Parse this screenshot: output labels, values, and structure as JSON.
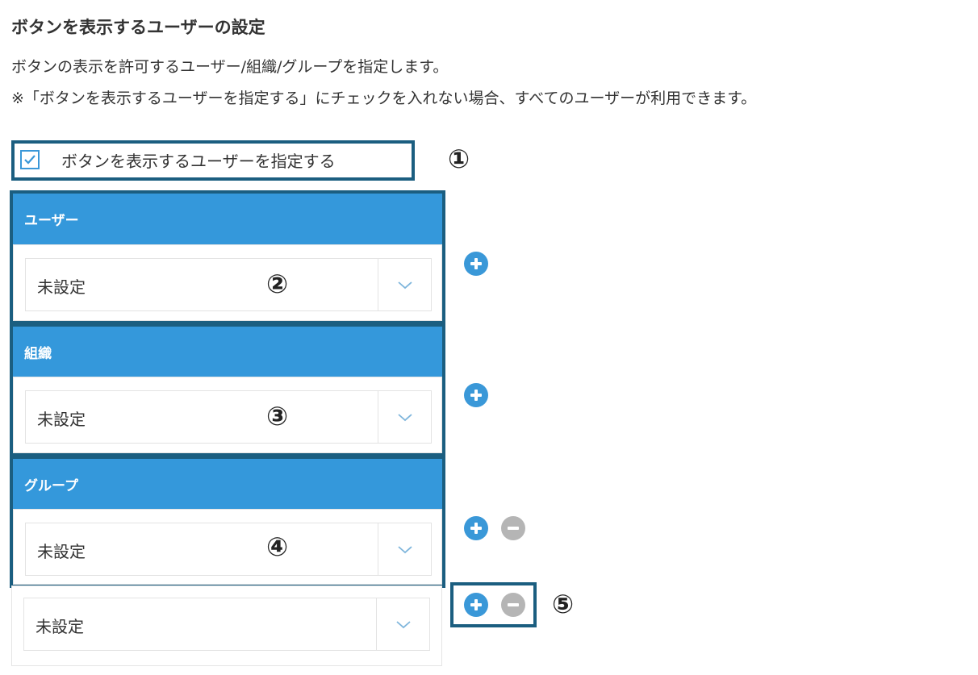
{
  "header": {
    "title": "ボタンを表示するユーザーの設定",
    "description_1": "ボタンの表示を許可するユーザー/組織/グループを指定します。",
    "description_2": "※「ボタンを表示するユーザーを指定する」にチェックを入れない場合、すべてのユーザーが利用できます。"
  },
  "checkbox": {
    "label": "ボタンを表示するユーザーを指定する",
    "checked": true
  },
  "callouts": {
    "n1": "①",
    "n2": "②",
    "n3": "③",
    "n4": "④",
    "n5": "⑤"
  },
  "sections": [
    {
      "heading": "ユーザー",
      "selected": "未設定"
    },
    {
      "heading": "組織",
      "selected": "未設定"
    },
    {
      "heading": "グループ",
      "selected": "未設定"
    }
  ],
  "extra_select": {
    "selected": "未設定"
  },
  "icons": {
    "add": "plus-circle-icon",
    "remove": "minus-circle-icon",
    "dropdown": "chevron-down-icon",
    "check": "checkmark-icon"
  },
  "colors": {
    "accent_blue": "#3498db",
    "annotation_frame": "#1b5e80",
    "remove_gray": "#b5b5b5"
  }
}
